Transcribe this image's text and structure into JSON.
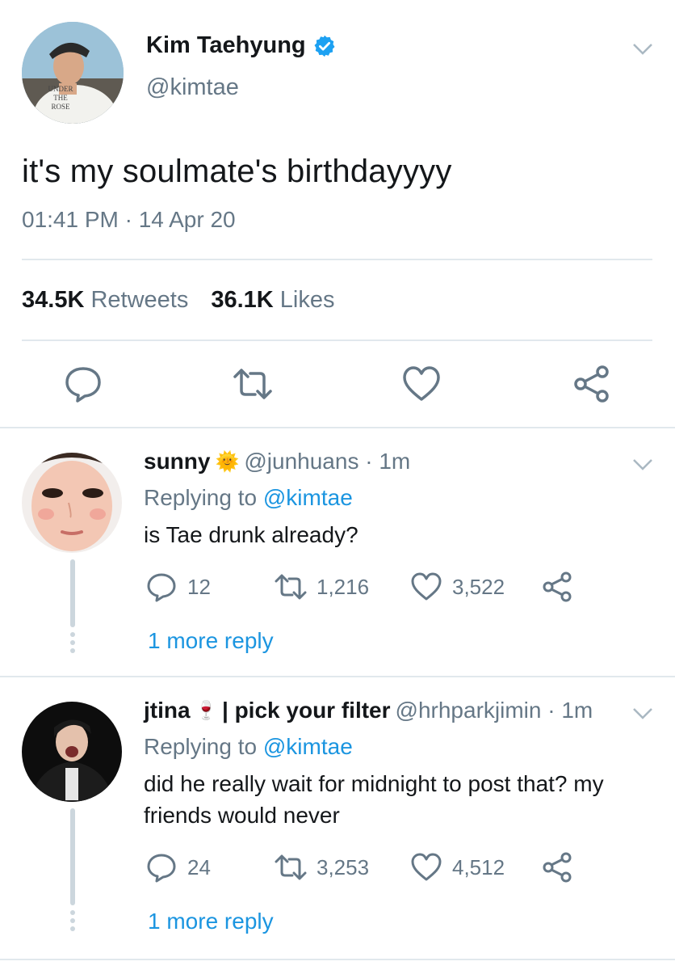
{
  "tweet": {
    "author": "Kim Taehyung",
    "handle": "@kimtae",
    "avatar_shirt_text": [
      "UNDER",
      "THE",
      "ROSE"
    ],
    "text": "it's my soulmate's birthdayyyy",
    "timestamp": "01:41 PM · 14 Apr 20",
    "retweets_count": "34.5K",
    "retweets_label": "Retweets",
    "likes_count": "36.1K",
    "likes_label": "Likes",
    "icons": [
      "reply-icon",
      "retweet-icon",
      "like-icon",
      "share-icon"
    ]
  },
  "replies": [
    {
      "name": "sunny",
      "name_emoji": "🌞",
      "handle_time": "@junhuans · 1m",
      "replying_prefix": "Replying to",
      "replying_handle": "@kimtae",
      "text": "is Tae drunk already?",
      "reply_count": "12",
      "retweet_count": "1,216",
      "like_count": "3,522",
      "more": "1 more reply"
    },
    {
      "name": "jtina",
      "name_emoji": "🍷",
      "name_suffix": "| pick your filter",
      "handle_time": "@hrhparkjimin · 1m",
      "replying_prefix": "Replying to",
      "replying_handle": "@kimtae",
      "text": "did he really wait for midnight to post that? my friends would never",
      "reply_count": "24",
      "retweet_count": "3,253",
      "like_count": "4,512",
      "more": "1 more reply"
    }
  ],
  "colors": {
    "link": "#1b95e0",
    "muted": "#657786",
    "divider": "#e1e8ed",
    "verified": "#1da1f2"
  }
}
